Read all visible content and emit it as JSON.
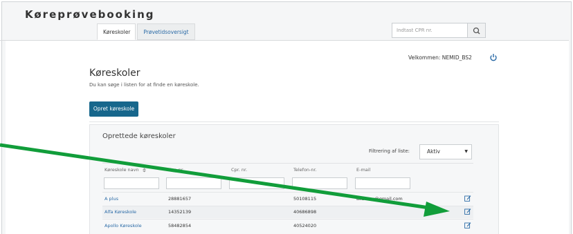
{
  "app": {
    "brand": "Køreprøvebooking"
  },
  "nav": {
    "tabs": [
      {
        "label": "Køreskoler",
        "active": true
      },
      {
        "label": "Prøvetidsoversigt",
        "active": false
      }
    ]
  },
  "search": {
    "placeholder": "Indtast CPR nr."
  },
  "user": {
    "welcome": "Velkommen: NEMID_BS2"
  },
  "page": {
    "title": "Køreskoler",
    "subtitle": "Du kan søge i listen for at finde en køreskole."
  },
  "actions": {
    "create_label": "Opret køreskole"
  },
  "list": {
    "title": "Oprettede køreskoler",
    "filter_label": "Filtrering af liste:",
    "filter_value": "Aktiv",
    "columns": [
      "Køreskole navn",
      "Cvr. nr.",
      "Cpr. nr.",
      "Telefon-nr.",
      "E-mail"
    ],
    "rows": [
      {
        "name": "A plus",
        "cvr": "28881657",
        "cpr": "",
        "phone": "50108115",
        "email": "aliabory@gmail.com"
      },
      {
        "name": "Alfa Køreskole",
        "cvr": "14352139",
        "cpr": "",
        "phone": "40686898",
        "email": ""
      },
      {
        "name": "Apollo Køreskole",
        "cvr": "58482854",
        "cpr": "",
        "phone": "40524020",
        "email": ""
      }
    ]
  },
  "colors": {
    "primary": "#17678c",
    "link": "#2a6aa6",
    "annotation_arrow": "#119d3a"
  },
  "icons": {
    "search": "search-icon",
    "power": "power-icon",
    "edit": "edit-icon",
    "sort": "sort-icon"
  }
}
